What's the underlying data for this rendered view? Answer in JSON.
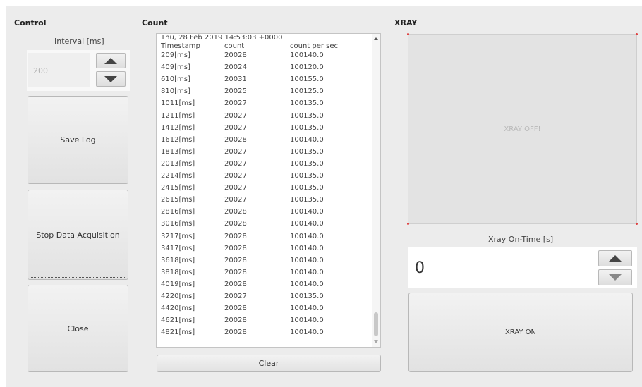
{
  "control": {
    "title": "Control",
    "interval_label": "Interval [ms]",
    "interval_value": "200",
    "save_log_label": "Save Log",
    "stop_label": "Stop Data Acquisition",
    "close_label": "Close"
  },
  "count": {
    "title": "Count",
    "date_line": "Thu, 28 Feb 2019 14:53:03 +0000",
    "headers": [
      "Timestamp",
      "count",
      "count per sec"
    ],
    "rows": [
      [
        "209[ms]",
        "20028",
        "100140.0"
      ],
      [
        "409[ms]",
        "20024",
        "100120.0"
      ],
      [
        "610[ms]",
        "20031",
        "100155.0"
      ],
      [
        "810[ms]",
        "20025",
        "100125.0"
      ],
      [
        "1011[ms]",
        "20027",
        "100135.0"
      ],
      [
        "1211[ms]",
        "20027",
        "100135.0"
      ],
      [
        "1412[ms]",
        "20027",
        "100135.0"
      ],
      [
        "1612[ms]",
        "20028",
        "100140.0"
      ],
      [
        "1813[ms]",
        "20027",
        "100135.0"
      ],
      [
        "2013[ms]",
        "20027",
        "100135.0"
      ],
      [
        "2214[ms]",
        "20027",
        "100135.0"
      ],
      [
        "2415[ms]",
        "20027",
        "100135.0"
      ],
      [
        "2615[ms]",
        "20027",
        "100135.0"
      ],
      [
        "2816[ms]",
        "20028",
        "100140.0"
      ],
      [
        "3016[ms]",
        "20028",
        "100140.0"
      ],
      [
        "3217[ms]",
        "20028",
        "100140.0"
      ],
      [
        "3417[ms]",
        "20028",
        "100140.0"
      ],
      [
        "3618[ms]",
        "20028",
        "100140.0"
      ],
      [
        "3818[ms]",
        "20028",
        "100140.0"
      ],
      [
        "4019[ms]",
        "20028",
        "100140.0"
      ],
      [
        "4220[ms]",
        "20027",
        "100135.0"
      ],
      [
        "4420[ms]",
        "20028",
        "100140.0"
      ],
      [
        "4621[ms]",
        "20028",
        "100140.0"
      ],
      [
        "4821[ms]",
        "20028",
        "100140.0"
      ]
    ],
    "clear_label": "Clear"
  },
  "xray": {
    "title": "XRAY",
    "status_text": "XRAY OFF!",
    "ontime_label": "Xray On-Time [s]",
    "ontime_value": "0",
    "on_button_label": "XRAY ON"
  },
  "icons": {
    "spin_up": "triangle-up-icon",
    "spin_down": "triangle-down-icon",
    "scroll_up": "scroll-up-icon",
    "scroll_down": "scroll-down-icon"
  },
  "colors": {
    "background": "#ececec",
    "display_bg": "#e3e3e3",
    "corner_marker": "#e04040"
  }
}
